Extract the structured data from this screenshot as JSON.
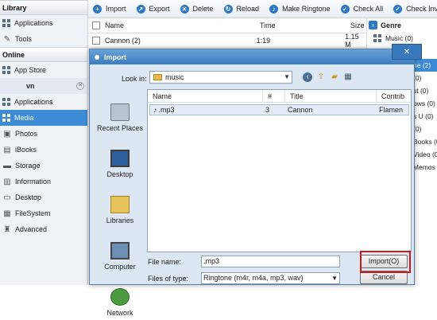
{
  "sidebar": {
    "library_label": "Library",
    "library_items": [
      {
        "label": "Applications",
        "icon": "grid-icon"
      },
      {
        "label": "Tools",
        "icon": "wrench-icon"
      }
    ],
    "online_label": "Online",
    "online_items": [
      {
        "label": "App Store",
        "icon": "grid-icon"
      }
    ],
    "device_name": "vn",
    "device_items": [
      {
        "label": "Applications",
        "icon": "grid-icon"
      },
      {
        "label": "Media",
        "icon": "grid-icon"
      },
      {
        "label": "Photos",
        "icon": "photo-icon"
      },
      {
        "label": "iBooks",
        "icon": "book-icon"
      },
      {
        "label": "Storage",
        "icon": "storage-icon"
      },
      {
        "label": "Information",
        "icon": "info-icon"
      },
      {
        "label": "Desktop",
        "icon": "desktop-icon"
      },
      {
        "label": "FileSystem",
        "icon": "filesystem-icon"
      },
      {
        "label": "Advanced",
        "icon": "advanced-icon"
      }
    ]
  },
  "toolbar": {
    "buttons": [
      "Import",
      "Export",
      "Delete",
      "Reload",
      "Make Ringtone",
      "Check All",
      "Check Invert"
    ]
  },
  "table": {
    "headers": [
      "Name",
      "Time",
      "Size"
    ],
    "rows": [
      {
        "name": "Cannon (2)",
        "time": "1:19",
        "size": "1.15 M"
      }
    ]
  },
  "genre": {
    "title": "Genre",
    "items": [
      "Music (0)",
      "ne (2)",
      "(0)",
      "st (0)",
      "ows (0)",
      "s U (0)",
      "(0)",
      "Books (0)",
      "Video (0)",
      "Memos (0)"
    ]
  },
  "dialog": {
    "title": "Import",
    "close_label": "✕",
    "look_in_label": "Look in:",
    "look_in_value": "music",
    "places": [
      "Recent Places",
      "Desktop",
      "Libraries",
      "Computer",
      "Network"
    ],
    "file_headers": [
      "Name",
      "#",
      "Title",
      "Contrib"
    ],
    "files": [
      {
        "name": ".mp3",
        "num": "3",
        "title": "Cannon",
        "contrib": "Flamen"
      }
    ],
    "file_name_label": "File name:",
    "file_name_value": ".mp3",
    "files_of_type_label": "Files of type:",
    "files_of_type_value": "Ringtone (m4r, m4a, mp3, wav)",
    "import_button": "Import(O)",
    "cancel_button": "Cancel"
  },
  "colors": {
    "accent": "#3d8bd6",
    "highlight": "#d01818"
  }
}
